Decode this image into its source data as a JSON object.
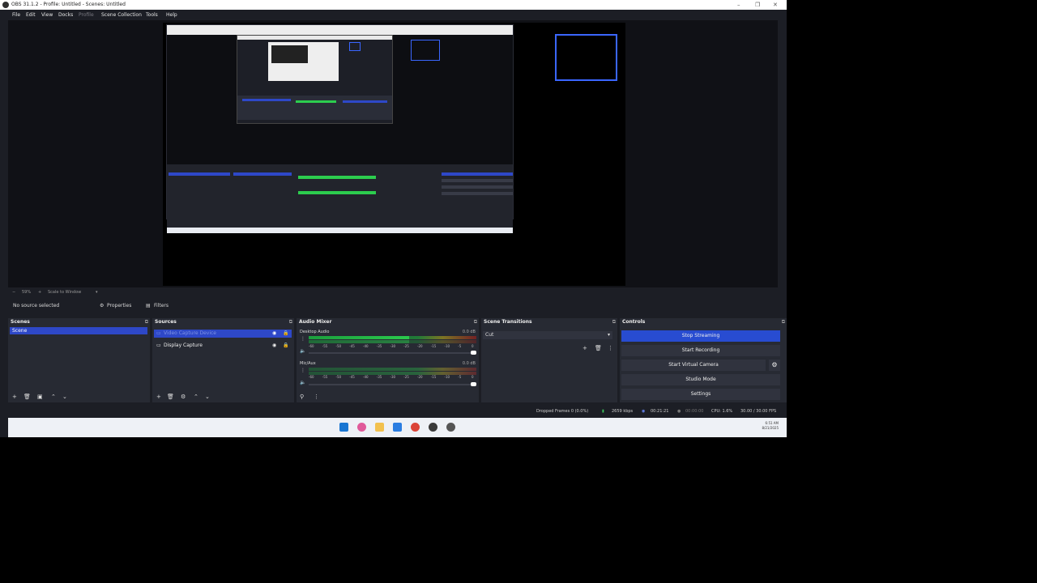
{
  "window": {
    "title": "OBS 31.1.2 - Profile: Untitled - Scenes: Untitled",
    "controls": [
      "–",
      "❐",
      "✕"
    ]
  },
  "menu": {
    "items": [
      "File",
      "Edit",
      "View",
      "Docks",
      "Profile",
      "Scene Collection",
      "Tools",
      "Help"
    ]
  },
  "preview_bar": {
    "zoom": "59%",
    "scale_mode": "Scale to Window"
  },
  "context_bar": {
    "selection": "No source selected",
    "properties_label": "Properties",
    "filters_label": "Filters"
  },
  "scenes": {
    "title": "Scenes",
    "items": [
      "Scene"
    ]
  },
  "sources": {
    "title": "Sources",
    "items": [
      {
        "label": "Video Capture Device",
        "selected": true
      },
      {
        "label": "Display Capture",
        "selected": false
      }
    ]
  },
  "audio_mixer": {
    "title": "Audio Mixer",
    "channels": [
      {
        "name": "Desktop Audio",
        "db": "0.0 dB",
        "level": 0.6
      },
      {
        "name": "Mic/Aux",
        "db": "0.0 dB",
        "level": 0.0
      }
    ],
    "scale_ticks": [
      "-60",
      "-55",
      "-50",
      "-45",
      "-40",
      "-35",
      "-30",
      "-25",
      "-20",
      "-15",
      "-10",
      "-5",
      "0"
    ]
  },
  "transitions": {
    "title": "Scene Transitions",
    "selected": "Cut"
  },
  "controls": {
    "title": "Controls",
    "buttons": [
      "Stop Streaming",
      "Start Recording",
      "Start Virtual Camera",
      "Studio Mode",
      "Settings"
    ]
  },
  "status": {
    "dropped_frames": "Dropped Frames 0 (0.0%)",
    "bitrate": "2659 kbps",
    "stream_time": "00:21:21",
    "record_time": "00:00:00",
    "cpu": "CPU: 1.6%",
    "fps": "30.00 / 30.00 FPS"
  },
  "taskbar": {
    "time": "6:51 AM",
    "date": "8/21/2025"
  },
  "colors": {
    "accent": "#284cd1",
    "panel": "#272a33",
    "background": "#1c1e25"
  }
}
